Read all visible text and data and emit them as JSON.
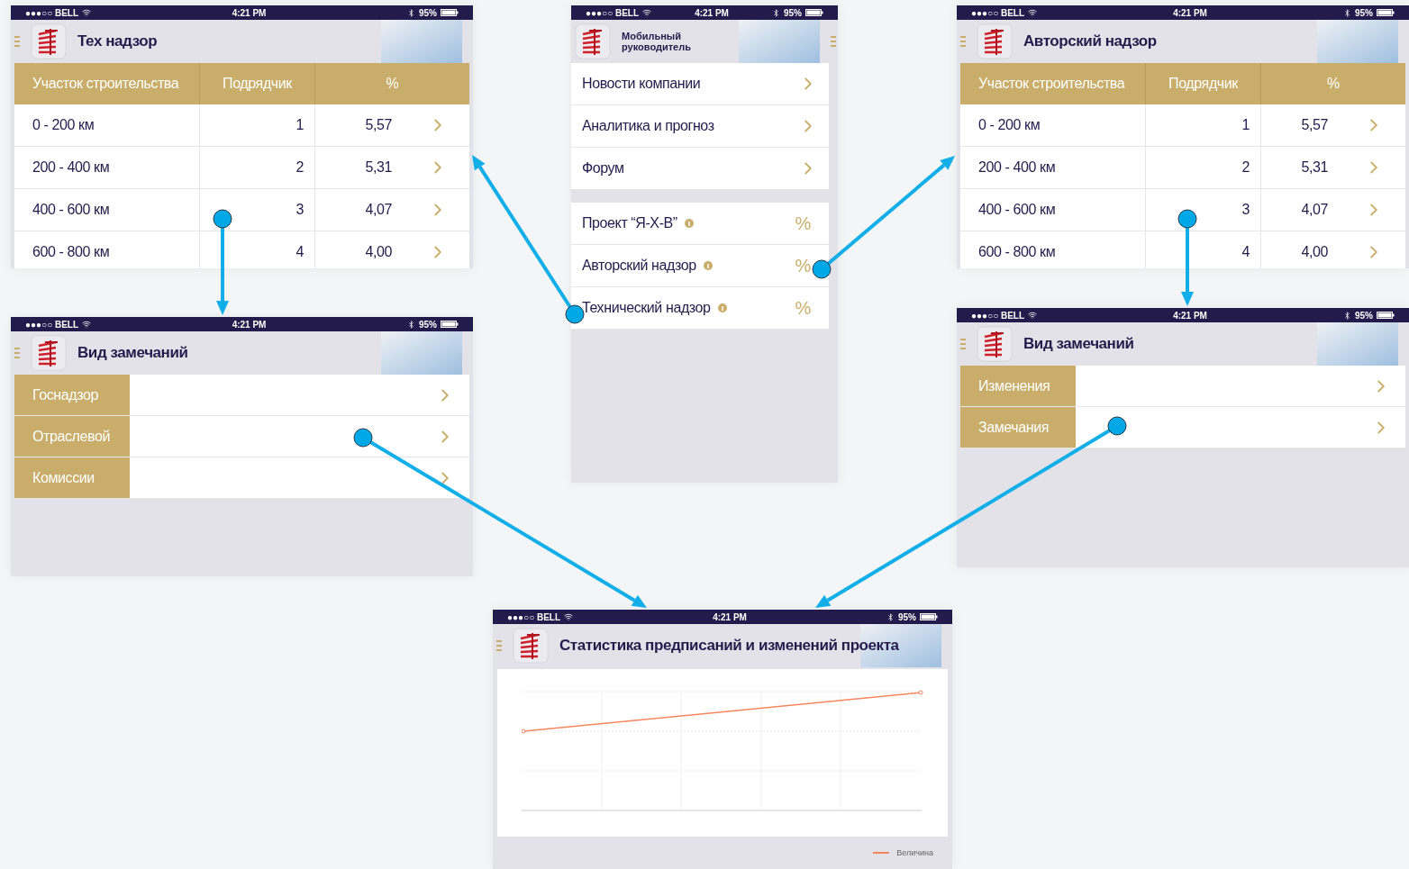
{
  "screens": [
    {
      "kind": "table",
      "status": {
        "carrier": "●●●○○ BELL",
        "time": "4:21 PM",
        "battery": "95%"
      },
      "title": "Тех надзор",
      "columns": [
        "Участок строительства",
        "Подрядчик",
        "%"
      ],
      "rows": [
        [
          "0 - 200 км",
          "1",
          "5,57"
        ],
        [
          "200 - 400 км",
          "2",
          "5,31"
        ],
        [
          "400 - 600 км",
          "3",
          "4,07"
        ],
        [
          "600 - 800 км",
          "4",
          "4,00"
        ]
      ]
    },
    {
      "kind": "menu",
      "status": {
        "carrier": "●●●○○ BELL",
        "time": "4:21 PM",
        "battery": "95%"
      },
      "title": "Мобильный руководитель",
      "groups": [
        [
          {
            "kind": "link",
            "label": "Новости компании"
          },
          {
            "kind": "link",
            "label": "Аналитика и прогноз"
          },
          {
            "kind": "link",
            "label": "Форум"
          }
        ],
        [
          {
            "kind": "percent",
            "label": "Проект “Я-Х-В”",
            "value": "%"
          },
          {
            "kind": "percent",
            "label": "Авторский надзор",
            "value": "%"
          },
          {
            "kind": "percent",
            "label": "Технический надзор",
            "value": "%"
          }
        ]
      ]
    },
    {
      "kind": "table",
      "status": {
        "carrier": "●●●○○ BELL",
        "time": "4:21 PM",
        "battery": "95%"
      },
      "title": "Авторский надзор",
      "columns": [
        "Участок строительства",
        "Подрядчик",
        "%"
      ],
      "rows": [
        [
          "0 - 200 км",
          "1",
          "5,57"
        ],
        [
          "200 - 400 км",
          "2",
          "5,31"
        ],
        [
          "400 - 600 км",
          "3",
          "4,07"
        ],
        [
          "600 - 800 км",
          "4",
          "4,00"
        ]
      ]
    },
    {
      "kind": "list",
      "status": {
        "carrier": "●●●○○ BELL",
        "time": "4:21 PM",
        "battery": "95%"
      },
      "title": "Вид замечаний",
      "items": [
        "Госнадзор",
        "Отраслевой",
        "Комиссии"
      ]
    },
    {
      "kind": "list",
      "status": {
        "carrier": "●●●○○ BELL",
        "time": "4:21 PM",
        "battery": "95%"
      },
      "title": "Вид замечаний",
      "items": [
        "Изменения",
        "Замечания"
      ]
    },
    {
      "kind": "chart",
      "status": {
        "carrier": "●●●○○ BELL",
        "time": "4:21 PM",
        "battery": "95%"
      },
      "title": "Статистика предписаний и изменений проекта",
      "legend": "Величина"
    }
  ]
}
